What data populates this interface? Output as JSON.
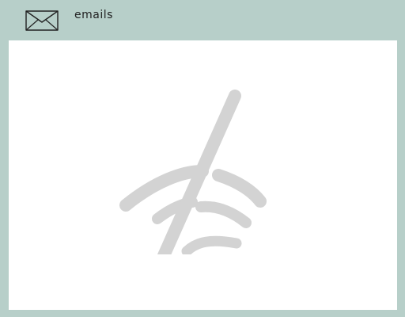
{
  "header": {
    "title": "emails",
    "icon": "mail-icon"
  },
  "main": {
    "status_icon": "no-wifi-icon",
    "colors": {
      "background": "#b7cfc9",
      "panel": "#ffffff",
      "icon": "#d3d3d3"
    }
  }
}
